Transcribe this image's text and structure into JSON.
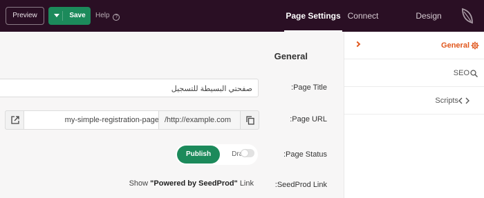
{
  "toolbar": {
    "preview_label": "Preview",
    "save_label": "Save",
    "help_label": "Help"
  },
  "tabs": [
    {
      "label": "Page Settings",
      "active": true
    },
    {
      "label": "Connect",
      "active": false
    },
    {
      "label": "Design",
      "active": false
    }
  ],
  "general": {
    "title": "General",
    "page_title_label": ":Page Title",
    "page_title_value": "صفحتي البسيطة للتسجيل",
    "page_url_label": ":Page URL",
    "url_prefix": "/http://example.com",
    "url_slug": "my-simple-registration-page",
    "page_status_label": ":Page Status",
    "status_options": [
      "Publish",
      "Draft"
    ],
    "status_selected": "Publish",
    "seedprod_link_label": ":SeedProd Link",
    "seedprod_show_text": "Show",
    "seedprod_powered_text": "\"Powered by SeedProd\"",
    "seedprod_link_word": "Link",
    "seedprod_link_enabled": false
  },
  "sidebar": {
    "items": [
      {
        "label": "General",
        "icon": "gear-icon",
        "active": true
      },
      {
        "label": "SEO",
        "icon": "magnifier-icon",
        "active": false
      },
      {
        "label": "Scripts",
        "icon": "code-icon",
        "active": false
      }
    ]
  },
  "colors": {
    "topbar": "#2a0f24",
    "accent_green": "#1c8a5b",
    "accent_orange": "#e0561b"
  }
}
